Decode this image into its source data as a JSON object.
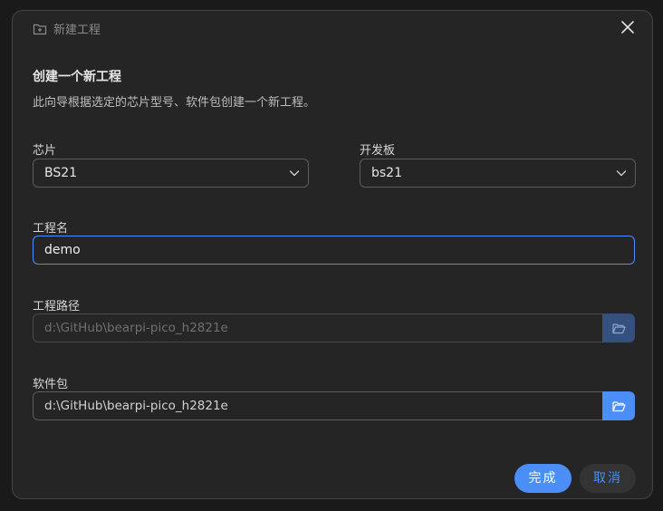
{
  "dialog": {
    "title": "新建工程",
    "heading": "创建一个新工程",
    "description": "此向导根据选定的芯片型号、软件包创建一个新工程。"
  },
  "chip": {
    "label": "芯片",
    "value": "BS21"
  },
  "board": {
    "label": "开发板",
    "value": "bs21"
  },
  "project_name": {
    "label": "工程名",
    "value": "demo"
  },
  "project_path": {
    "label": "工程路径",
    "value": "d:\\GitHub\\bearpi-pico_h2821e",
    "disabled": true
  },
  "package": {
    "label": "软件包",
    "value": "d:\\GitHub\\bearpi-pico_h2821e"
  },
  "buttons": {
    "finish": "完成",
    "cancel": "取消"
  },
  "colors": {
    "accent": "#4c8ef7",
    "background": "#252525",
    "border": "#444444"
  },
  "icons": {
    "title": "folder-plus-icon",
    "close": "close-icon",
    "chevron": "chevron-down-icon",
    "browse": "folder-open-icon"
  }
}
